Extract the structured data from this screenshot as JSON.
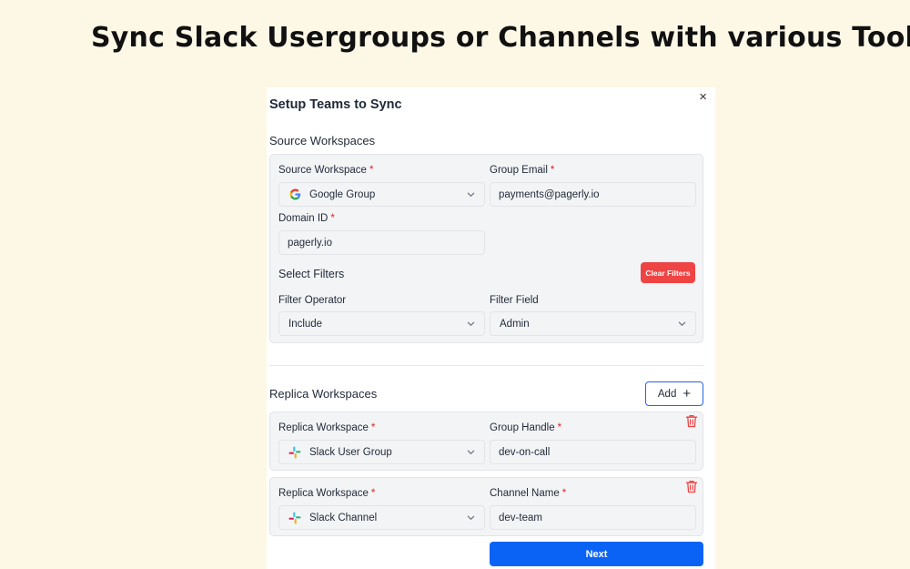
{
  "headline": "Sync Slack Usergroups or Channels with various Tools",
  "modal": {
    "title": "Setup Teams to Sync",
    "close_label": "×"
  },
  "source": {
    "section_title": "Source Workspaces",
    "source_workspace_label": "Source Workspace",
    "source_workspace_value": "Google Group",
    "group_email_label": "Group Email",
    "group_email_value": "payments@pagerly.io",
    "domain_id_label": "Domain ID",
    "domain_id_value": "pagerly.io",
    "required_mark": "*"
  },
  "filters": {
    "title": "Select Filters",
    "clear_button": "Clear Filters",
    "operator_label": "Filter Operator",
    "operator_value": "Include",
    "field_label": "Filter Field",
    "field_value": "Admin"
  },
  "replica": {
    "section_title": "Replica Workspaces",
    "add_button": "Add",
    "add_icon": "+",
    "items": [
      {
        "workspace_label": "Replica Workspace",
        "workspace_value": "Slack User Group",
        "target_label": "Group Handle",
        "target_value": "dev-on-call"
      },
      {
        "workspace_label": "Replica Workspace",
        "workspace_value": "Slack Channel",
        "target_label": "Channel Name",
        "target_value": "dev-team"
      }
    ]
  },
  "next_button": "Next",
  "colors": {
    "background": "#fdf8e6",
    "danger": "#ef4444",
    "primary": "#0b63f6",
    "required": "#dc2626"
  }
}
